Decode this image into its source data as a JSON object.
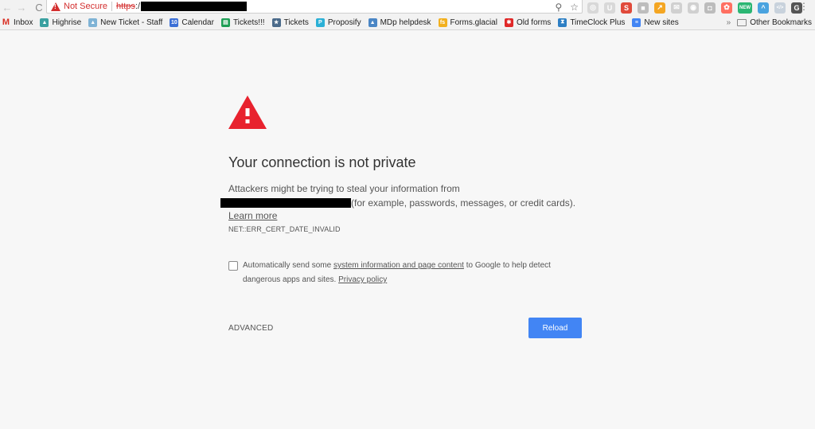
{
  "browser": {
    "nav": {
      "back_icon": "←",
      "forward_icon": "→",
      "reload_icon": "C"
    },
    "omnibox": {
      "security_label": "Not Secure",
      "scheme": "https",
      "scheme_rest": ":/",
      "zoom_icon": "⚲",
      "star_icon": "☆"
    },
    "extensions": [
      {
        "name": "ext-1",
        "glyph": "◎",
        "color": "#d8d8d8"
      },
      {
        "name": "ext-2",
        "glyph": "U",
        "color": "#d8d8d8"
      },
      {
        "name": "ext-seo",
        "glyph": "S",
        "color": "#e04a3b"
      },
      {
        "name": "ext-4",
        "glyph": "■",
        "color": "#bdbdbd"
      },
      {
        "name": "ext-analytics",
        "glyph": "↗",
        "color": "#f4a623"
      },
      {
        "name": "ext-6",
        "glyph": "✉",
        "color": "#d0d0d0"
      },
      {
        "name": "ext-7",
        "glyph": "◉",
        "color": "#d0d0d0"
      },
      {
        "name": "ext-camera",
        "glyph": "◘",
        "color": "#bcbcbc"
      },
      {
        "name": "ext-color",
        "glyph": "✿",
        "color": "#ff6f61"
      },
      {
        "name": "ext-new",
        "glyph": "NEW",
        "color": "#2bb673"
      },
      {
        "name": "ext-arc",
        "glyph": "^",
        "color": "#4aa3df"
      },
      {
        "name": "ext-code",
        "glyph": "</>",
        "color": "#c8d2dc"
      },
      {
        "name": "ext-g",
        "glyph": "G",
        "color": "#555555"
      }
    ],
    "menu_icon": "⋮"
  },
  "bookmarks": {
    "items": [
      {
        "label": "Inbox",
        "icon": "M",
        "color": "#d93025",
        "text_icon": true
      },
      {
        "label": "Highrise",
        "icon": "▲",
        "color": "#3aa0a0"
      },
      {
        "label": "New Ticket - Staff",
        "icon": "▲",
        "color": "#7fb3d5"
      },
      {
        "label": "Calendar",
        "icon": "10",
        "color": "#3b6fd6"
      },
      {
        "label": "Tickets!!!",
        "icon": "▤",
        "color": "#1e9e55"
      },
      {
        "label": "Tickets",
        "icon": "★",
        "color": "#4a6a8a"
      },
      {
        "label": "Proposify",
        "icon": "P",
        "color": "#2bb0d6"
      },
      {
        "label": "MDp helpdesk",
        "icon": "▲",
        "color": "#4a86c5"
      },
      {
        "label": "Forms.glacial",
        "icon": "fs",
        "color": "#f2b01e"
      },
      {
        "label": "Old forms",
        "icon": "✱",
        "color": "#e02828"
      },
      {
        "label": "TimeClock Plus",
        "icon": "⧗",
        "color": "#2d7fc4"
      },
      {
        "label": "New sites",
        "icon": "≡",
        "color": "#4285f4"
      }
    ],
    "overflow": "»",
    "other_label": "Other Bookmarks"
  },
  "interstitial": {
    "heading": "Your connection is not private",
    "desc_line1": "Attackers might be trying to steal your information from",
    "desc_line2": "(for example, passwords, messages, or credit cards).",
    "learn_more": "Learn more",
    "error_code": "NET::ERR_CERT_DATE_INVALID",
    "optin": {
      "checked": false,
      "prefix": "Automatically send some ",
      "link1": "system information and page content",
      "middle": " to Google to help detect dangerous apps and sites. ",
      "link2": "Privacy policy"
    },
    "advanced_label": "ADVANCED",
    "reload_label": "Reload",
    "colors": {
      "warning_red": "#e8222e",
      "button_blue": "#4285f4",
      "background": "#f7f7f7"
    }
  }
}
